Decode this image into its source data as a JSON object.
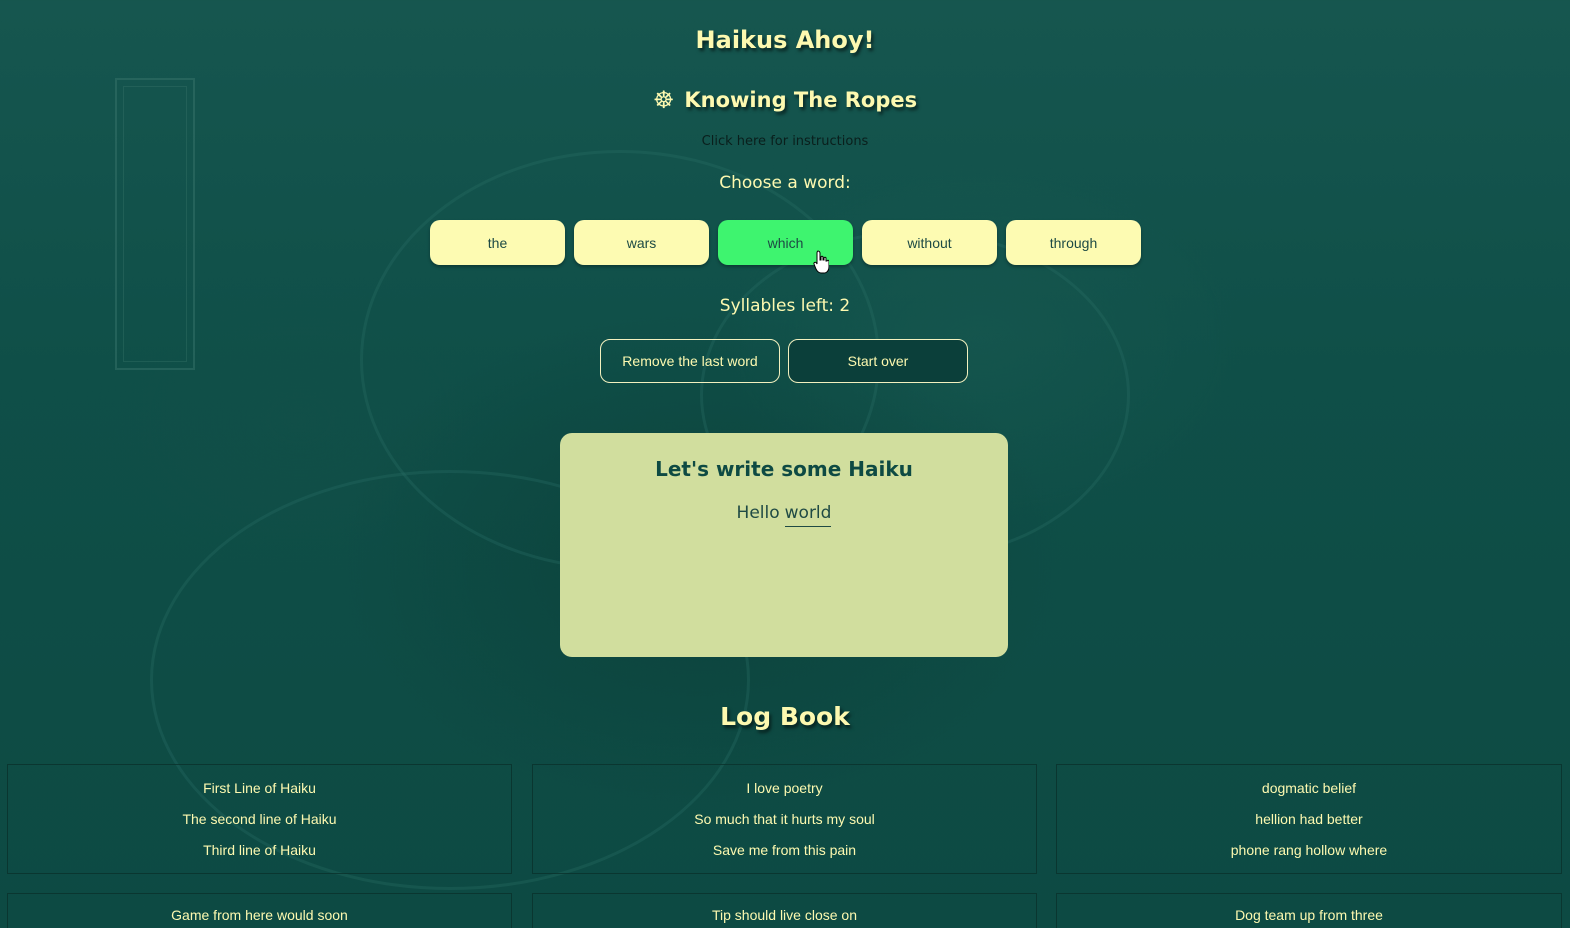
{
  "app": {
    "title": "Haikus Ahoy!"
  },
  "instructions": {
    "heading": "Knowing The Ropes",
    "icon": "ship-wheel-icon",
    "link": "Click here for instructions"
  },
  "chooser": {
    "prompt": "Choose a word:",
    "words": [
      "the",
      "wars",
      "which",
      "without",
      "through"
    ],
    "active_word": "which",
    "syllables_left": "Syllables left: 2"
  },
  "actions": {
    "remove_last": "Remove the last word",
    "start_over": "Start over"
  },
  "editor": {
    "title": "Let's write some Haiku",
    "words": [
      "Hello",
      "world"
    ]
  },
  "logbook": {
    "title": "Log Book",
    "entries": [
      {
        "lines": [
          "First Line of Haiku",
          "The second line of Haiku",
          "Third line of Haiku"
        ]
      },
      {
        "lines": [
          "I love poetry",
          "So much that it hurts my soul",
          "Save me from this pain"
        ]
      },
      {
        "lines": [
          "dogmatic belief",
          "hellion had better",
          "phone rang hollow where"
        ]
      },
      {
        "lines": [
          "Game from here would soon"
        ]
      },
      {
        "lines": [
          "Tip should live close on"
        ]
      },
      {
        "lines": [
          "Dog team up from three"
        ]
      }
    ]
  },
  "colors": {
    "background": "#0f4f48",
    "accent_text": "#fdf9b0",
    "word_button": "#fdfbb2",
    "word_active": "#3ef46f",
    "card": "#d1de9e"
  }
}
